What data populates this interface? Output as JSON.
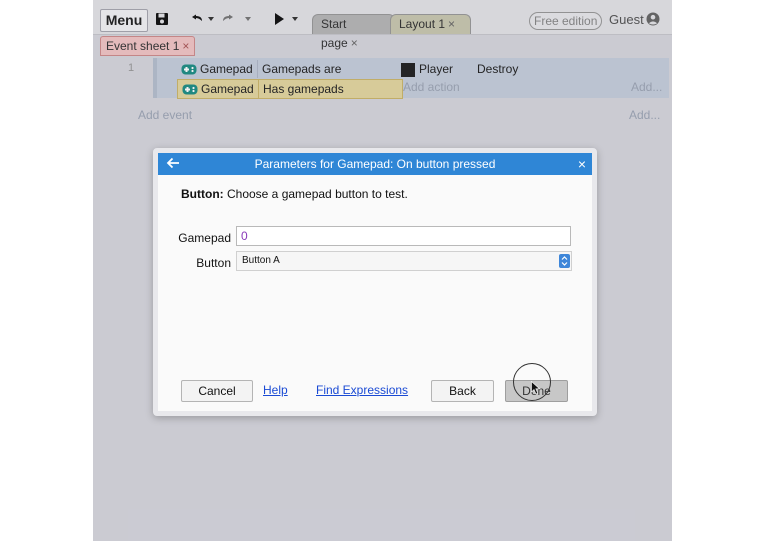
{
  "toolbar": {
    "menu_label": "Menu",
    "tabs": [
      {
        "label": "Start page",
        "close": "×"
      },
      {
        "label": "Layout 1",
        "close": "×"
      }
    ],
    "free_edition": "Free edition",
    "guest_label": "Guest"
  },
  "sheet_tab": {
    "label": "Event sheet 1",
    "close": "×"
  },
  "event": {
    "number": "1",
    "conditions": [
      {
        "object": "Gamepad",
        "text": "Gamepads are supported"
      },
      {
        "object": "Gamepad",
        "text": "Has gamepads"
      }
    ],
    "action": {
      "object": "Player",
      "text": "Destroy"
    },
    "add_action": "Add action",
    "add_dots": "Add..."
  },
  "add_event": "Add event",
  "add_event_dots": "Add...",
  "dialog": {
    "title": "Parameters for Gamepad: On button pressed",
    "close": "×",
    "desc_label": "Button:",
    "desc_text": " Choose a gamepad button to test.",
    "params": {
      "gamepad_label": "Gamepad",
      "gamepad_value": "0",
      "button_label": "Button",
      "button_value": "Button A"
    },
    "buttons": {
      "cancel": "Cancel",
      "help": "Help",
      "find_expressions": "Find Expressions",
      "back": "Back",
      "done": "Done"
    }
  },
  "colors": {
    "dialog_header": "#2f86d6",
    "link": "#1a4ad4",
    "gamepad_value": "#8a3ab9",
    "event_bg": "#c6cfdd",
    "selected_condition": "#e4d7a0"
  }
}
